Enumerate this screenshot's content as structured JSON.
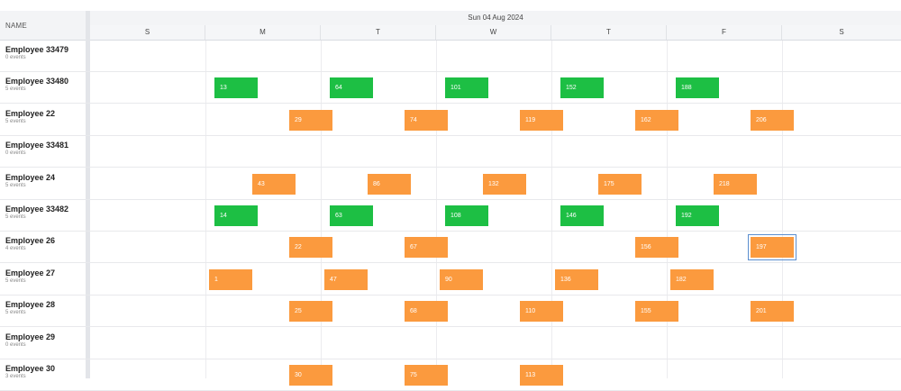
{
  "header": {
    "name_col_label": "NAME",
    "date_label": "Sun 04 Aug 2024",
    "days": [
      "S",
      "M",
      "T",
      "W",
      "T",
      "F",
      "S"
    ]
  },
  "colors": {
    "green_event": "#1dbf44",
    "orange_event": "#fb9a3e",
    "selection": "#5b8ecf"
  },
  "rows": [
    {
      "name": "Employee 33479",
      "sub": "0 events",
      "events": []
    },
    {
      "name": "Employee 33480",
      "sub": "5 events",
      "events": [
        {
          "label": "13",
          "color": "green",
          "day": 1
        },
        {
          "label": "64",
          "color": "green",
          "day": 2
        },
        {
          "label": "101",
          "color": "green",
          "day": 3
        },
        {
          "label": "152",
          "color": "green",
          "day": 4
        },
        {
          "label": "188",
          "color": "green",
          "day": 5
        }
      ]
    },
    {
      "name": "Employee 22",
      "sub": "5 events",
      "events": [
        {
          "label": "29",
          "color": "orange",
          "day": 1.65
        },
        {
          "label": "74",
          "color": "orange",
          "day": 2.65
        },
        {
          "label": "119",
          "color": "orange",
          "day": 3.65
        },
        {
          "label": "162",
          "color": "orange",
          "day": 4.65
        },
        {
          "label": "206",
          "color": "orange",
          "day": 5.65
        }
      ]
    },
    {
      "name": "Employee 33481",
      "sub": "0 events",
      "events": []
    },
    {
      "name": "Employee 24",
      "sub": "5 events",
      "events": [
        {
          "label": "43",
          "color": "orange",
          "day": 1.33
        },
        {
          "label": "86",
          "color": "orange",
          "day": 2.33
        },
        {
          "label": "132",
          "color": "orange",
          "day": 3.33
        },
        {
          "label": "175",
          "color": "orange",
          "day": 4.33
        },
        {
          "label": "218",
          "color": "orange",
          "day": 5.33
        }
      ]
    },
    {
      "name": "Employee 33482",
      "sub": "5 events",
      "events": [
        {
          "label": "14",
          "color": "green",
          "day": 1
        },
        {
          "label": "63",
          "color": "green",
          "day": 2
        },
        {
          "label": "108",
          "color": "green",
          "day": 3
        },
        {
          "label": "146",
          "color": "green",
          "day": 4
        },
        {
          "label": "192",
          "color": "green",
          "day": 5
        }
      ]
    },
    {
      "name": "Employee 26",
      "sub": "4 events",
      "events": [
        {
          "label": "22",
          "color": "orange",
          "day": 1.65
        },
        {
          "label": "67",
          "color": "orange",
          "day": 2.65
        },
        {
          "label": "156",
          "color": "orange",
          "day": 4.65
        },
        {
          "label": "197",
          "color": "orange",
          "day": 5.65,
          "selected": true
        }
      ]
    },
    {
      "name": "Employee 27",
      "sub": "5 events",
      "events": [
        {
          "label": "1",
          "color": "orange",
          "day": 0.95
        },
        {
          "label": "47",
          "color": "orange",
          "day": 1.95
        },
        {
          "label": "90",
          "color": "orange",
          "day": 2.95
        },
        {
          "label": "136",
          "color": "orange",
          "day": 3.95
        },
        {
          "label": "182",
          "color": "orange",
          "day": 4.95
        }
      ]
    },
    {
      "name": "Employee 28",
      "sub": "5 events",
      "events": [
        {
          "label": "25",
          "color": "orange",
          "day": 1.65
        },
        {
          "label": "68",
          "color": "orange",
          "day": 2.65
        },
        {
          "label": "110",
          "color": "orange",
          "day": 3.65
        },
        {
          "label": "155",
          "color": "orange",
          "day": 4.65
        },
        {
          "label": "201",
          "color": "orange",
          "day": 5.65
        }
      ]
    },
    {
      "name": "Employee 29",
      "sub": "0 events",
      "events": []
    },
    {
      "name": "Employee 30",
      "sub": "3 events",
      "events": [
        {
          "label": "30",
          "color": "orange",
          "day": 1.65
        },
        {
          "label": "75",
          "color": "orange",
          "day": 2.65
        },
        {
          "label": "113",
          "color": "orange",
          "day": 3.65
        }
      ]
    }
  ]
}
